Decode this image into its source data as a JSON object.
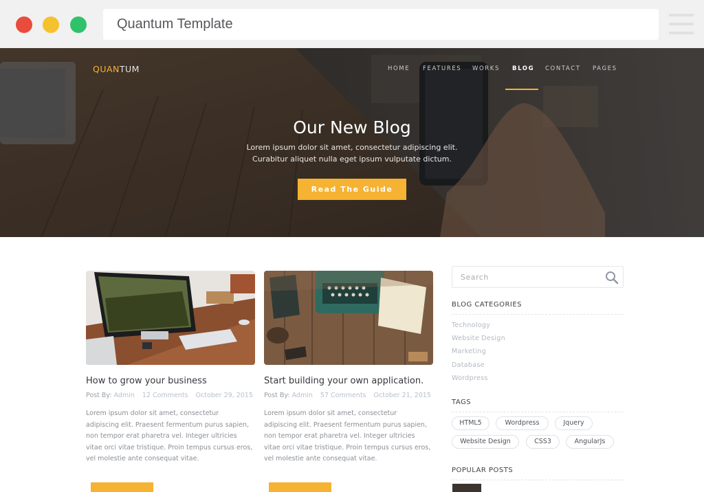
{
  "window": {
    "title": "Quantum Template"
  },
  "brand": {
    "logo_accent": "QUAN",
    "logo_rest": "TUM",
    "accent_color": "#f6b232"
  },
  "nav": {
    "items": [
      {
        "label": "HOME"
      },
      {
        "label": "FEATURES"
      },
      {
        "label": "WORKS"
      },
      {
        "label": "BLOG"
      },
      {
        "label": "CONTACT"
      },
      {
        "label": "PAGES"
      }
    ],
    "active": "BLOG"
  },
  "hero": {
    "title": "Our New Blog",
    "subtitle_line1": "Lorem ipsum dolor sit amet, consectetur adipiscing elit.",
    "subtitle_line2": "Curabitur aliquet nulla eget ipsum vulputate dictum.",
    "button_label": "Read The Guide"
  },
  "posts": [
    {
      "title": "How to grow your business",
      "by_label": "Post By:",
      "author": "Admin",
      "comments": "12 Comments",
      "date": "October 29, 2015",
      "excerpt_lines": [
        "Lorem ipsum dolor sit amet, consectetur",
        "adipiscing elit. Praesent fermentum purus sapien,",
        "non tempor erat pharetra vel. Integer ultricies",
        "vitae orci vitae tristique. Proin tempus cursus eros,",
        "vel molestie ante consequat vitae."
      ]
    },
    {
      "title": "Start building your own application.",
      "by_label": "Post By:",
      "author": "Admin",
      "comments": "57 Comments",
      "date": "October 21, 2015",
      "excerpt_lines": [
        "Lorem ipsum dolor sit amet, consectetur",
        "adipiscing elit. Praesent fermentum purus sapien,",
        "non tempor erat pharetra vel. Integer ultricies",
        "vitae orci vitae tristique. Proin tempus cursus eros,",
        "vel molestie ante consequat vitae."
      ]
    }
  ],
  "sidebar": {
    "search_placeholder": "Search",
    "categories_heading": "BLOG CATEGORIES",
    "categories": [
      "Technology",
      "Website Design",
      "Marketing",
      "Database",
      "Wordpress"
    ],
    "tags_heading": "TAGS",
    "tags": [
      "HTML5",
      "Wordpress",
      "Jquery",
      "Website Design",
      "CSS3",
      "AngularJs"
    ],
    "popular_heading": "POPULAR POSTS"
  }
}
